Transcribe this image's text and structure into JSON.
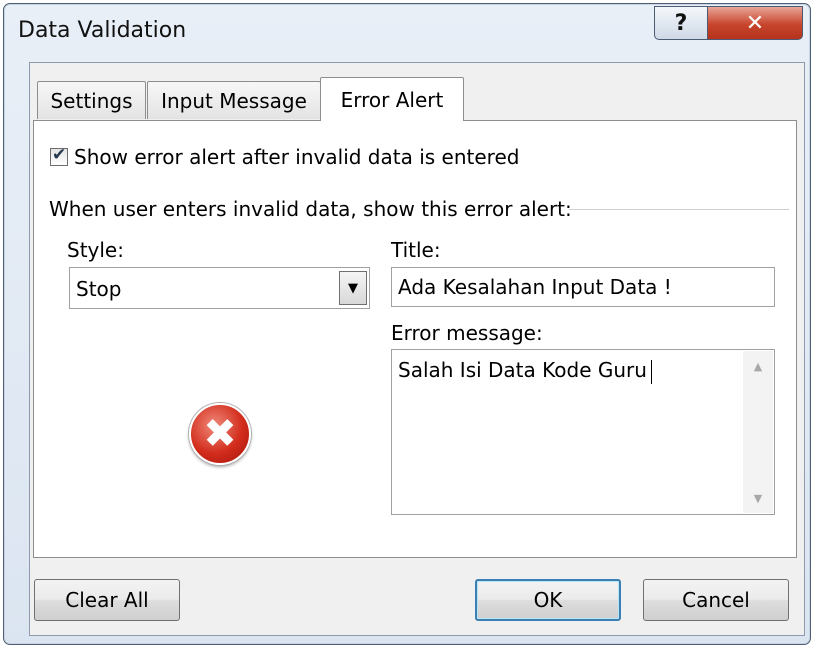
{
  "window": {
    "title": "Data Validation",
    "help_glyph": "?",
    "close_glyph": "✕"
  },
  "tabs": [
    {
      "label": "Settings",
      "active": false
    },
    {
      "label": "Input Message",
      "active": false
    },
    {
      "label": "Error Alert",
      "active": true
    }
  ],
  "error_alert": {
    "show_checkbox_label": "Show error alert after invalid data is entered",
    "show_checked": true,
    "group_label": "When user enters invalid data, show this error alert:",
    "style_label": "Style:",
    "style_value": "Stop",
    "title_label": "Title:",
    "title_value": "Ada Kesalahan Input Data !",
    "message_label": "Error message:",
    "message_value": "Salah Isi Data Kode Guru",
    "icon": "stop-error-icon"
  },
  "buttons": {
    "clear_all": "Clear All",
    "ok": "OK",
    "cancel": "Cancel"
  },
  "colors": {
    "close_button": "#c8452c",
    "stop_icon": "#d22c1c",
    "default_button_border": "#3c7fb1"
  }
}
